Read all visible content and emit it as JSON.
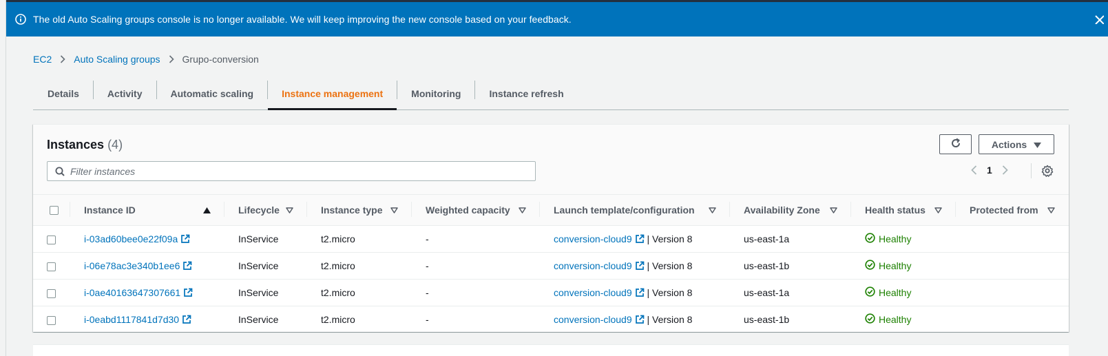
{
  "banner": {
    "message": "The old Auto Scaling groups console is no longer available. We will keep improving the new console based on your feedback.",
    "color": "#0073bb"
  },
  "breadcrumb": {
    "items": [
      "EC2",
      "Auto Scaling groups"
    ],
    "current": "Grupo-conversion"
  },
  "tabs": [
    {
      "label": "Details"
    },
    {
      "label": "Activity"
    },
    {
      "label": "Automatic scaling"
    },
    {
      "label": "Instance management",
      "active": true
    },
    {
      "label": "Monitoring"
    },
    {
      "label": "Instance refresh"
    }
  ],
  "instances": {
    "title": "Instances",
    "count": "(4)",
    "actions_label": "Actions",
    "search_placeholder": "Filter instances",
    "page": "1"
  },
  "table": {
    "columns": [
      "Instance ID",
      "Lifecycle",
      "Instance type",
      "Weighted capacity",
      "Launch template/configuration",
      "Availability Zone",
      "Health status",
      "Protected from"
    ],
    "rows": [
      {
        "id": "i-03ad60bee0e22f09a",
        "lifecycle": "InService",
        "type": "t2.micro",
        "weight": "-",
        "template": "conversion-cloud9",
        "version": "| Version 8",
        "az": "us-east-1a",
        "health": "Healthy",
        "protected": ""
      },
      {
        "id": "i-06e78ac3e340b1ee6",
        "lifecycle": "InService",
        "type": "t2.micro",
        "weight": "-",
        "template": "conversion-cloud9",
        "version": "| Version 8",
        "az": "us-east-1b",
        "health": "Healthy",
        "protected": ""
      },
      {
        "id": "i-0ae40163647307661",
        "lifecycle": "InService",
        "type": "t2.micro",
        "weight": "-",
        "template": "conversion-cloud9",
        "version": "| Version 8",
        "az": "us-east-1a",
        "health": "Healthy",
        "protected": ""
      },
      {
        "id": "i-0eabd1117841d7d30",
        "lifecycle": "InService",
        "type": "t2.micro",
        "weight": "-",
        "template": "conversion-cloud9",
        "version": "| Version 8",
        "az": "us-east-1b",
        "health": "Healthy",
        "protected": ""
      }
    ]
  },
  "colors": {
    "accent": "#ec7211",
    "link": "#0073bb",
    "healthy": "#1d8102"
  },
  "icons": [
    "info-icon",
    "close-icon",
    "chevron-right-icon",
    "refresh-icon",
    "caret-down-icon",
    "search-icon",
    "chevron-left-icon",
    "settings-icon",
    "sort-ascending-icon",
    "filter-caret-icon",
    "external-link-icon",
    "check-circle-icon"
  ]
}
